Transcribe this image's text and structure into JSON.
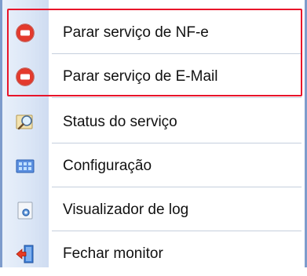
{
  "menu": {
    "items": [
      {
        "label": "Parar serviço de NF-e",
        "icon": "stop-icon"
      },
      {
        "label": "Parar serviço de E-Mail",
        "icon": "stop-icon"
      },
      {
        "label": "Status do serviço",
        "icon": "status-magnifier-icon"
      },
      {
        "label": "Configuração",
        "icon": "configuration-icon"
      },
      {
        "label": "Visualizador de log",
        "icon": "log-viewer-icon"
      },
      {
        "label": "Fechar monitor",
        "icon": "exit-door-icon"
      }
    ],
    "highlight_color": "#e8142a",
    "stop_icon_color": "#e43a2d"
  }
}
